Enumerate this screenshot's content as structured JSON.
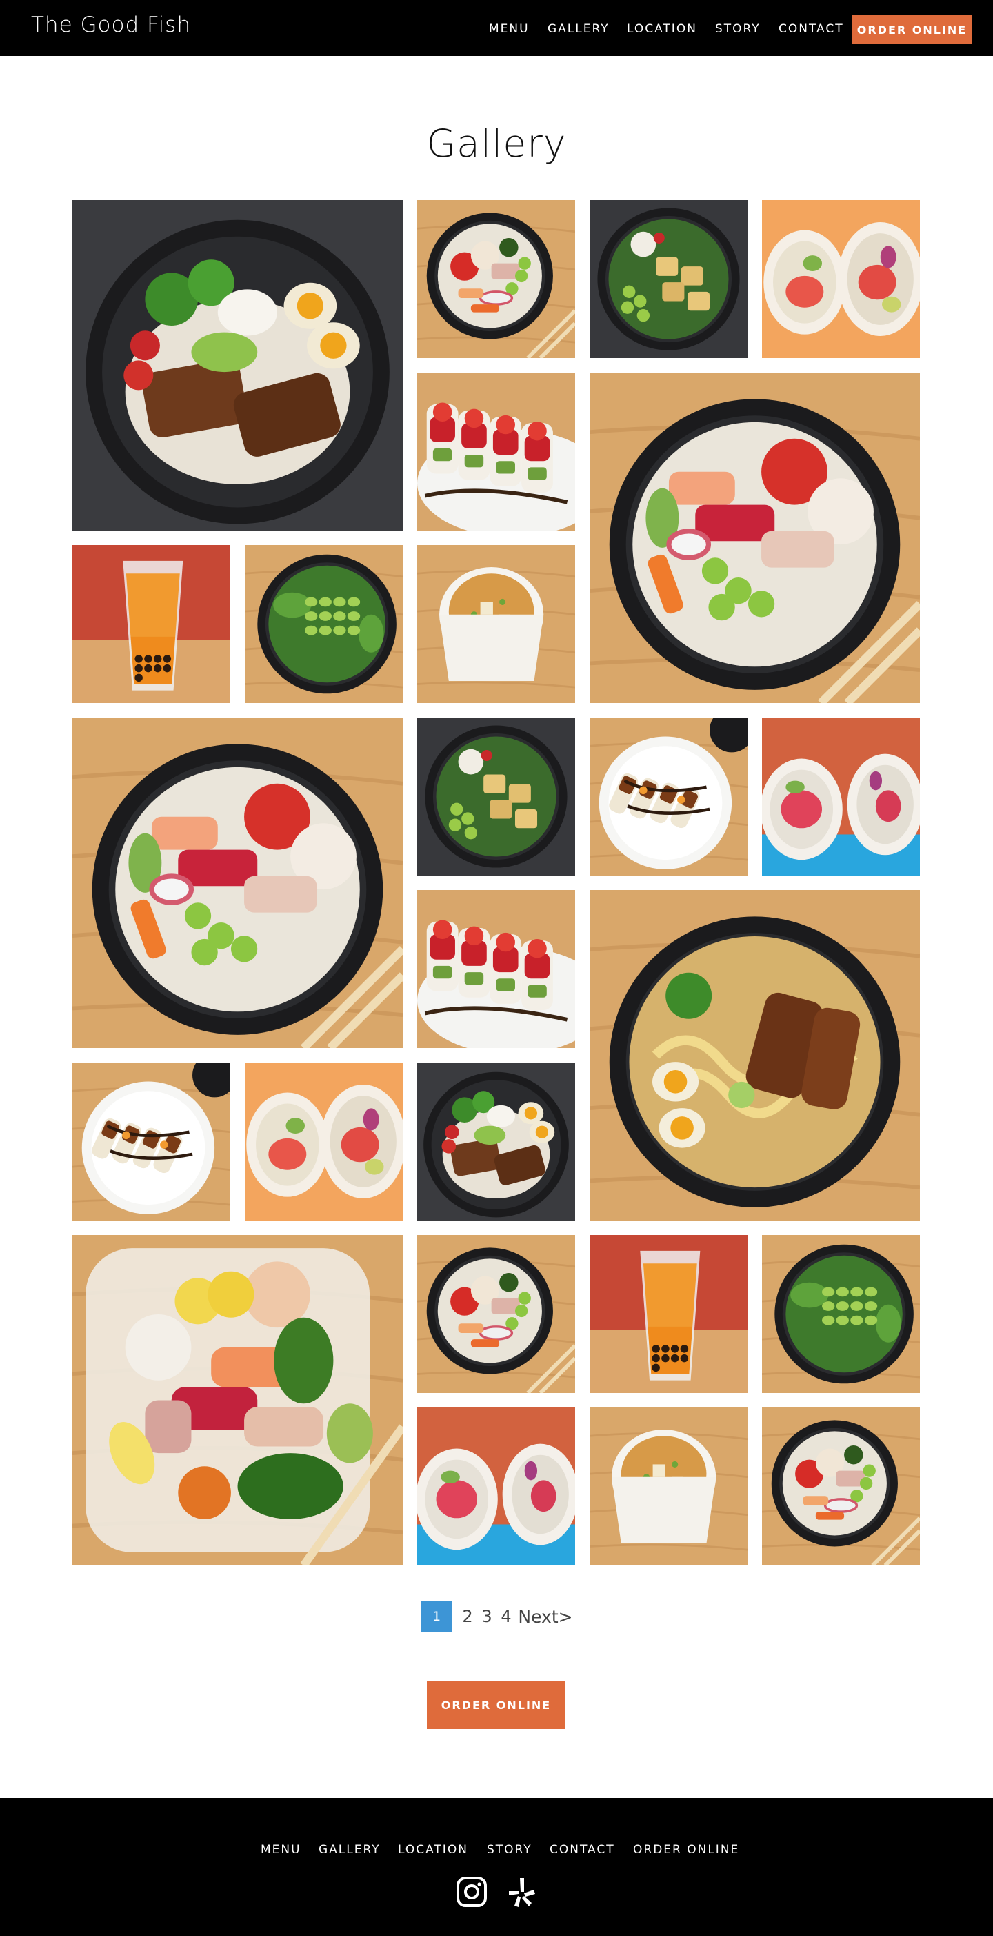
{
  "header": {
    "brand": "The Good Fish",
    "nav": [
      "MENU",
      "GALLERY",
      "LOCATION",
      "STORY",
      "CONTACT"
    ],
    "order_button": "ORDER ONLINE"
  },
  "page_title": "Gallery",
  "pagination": {
    "pages": [
      "1",
      "2",
      "3",
      "4"
    ],
    "current": "1",
    "next_label": "Next>"
  },
  "order_button_main": "ORDER ONLINE",
  "footer": {
    "links": [
      "MENU",
      "GALLERY",
      "LOCATION",
      "STORY",
      "CONTACT",
      "ORDER ONLINE"
    ],
    "social_icons": [
      "instagram-icon",
      "yelp-icon"
    ]
  },
  "gallery": {
    "photos": [
      {
        "subject": "pork-rice-bowl"
      },
      {
        "subject": "poke-bowl"
      },
      {
        "subject": "tofu-bowl"
      },
      {
        "subject": "sushi-burrito"
      },
      {
        "subject": "sushi-roll"
      },
      {
        "subject": "poke-bowl-large"
      },
      {
        "subject": "thai-tea"
      },
      {
        "subject": "edamame-salad"
      },
      {
        "subject": "miso-soup"
      },
      {
        "subject": "poke-bowl-large"
      },
      {
        "subject": "tofu-bowl"
      },
      {
        "subject": "eel-roll-plate"
      },
      {
        "subject": "sushi-burrito-blue"
      },
      {
        "subject": "sushi-roll"
      },
      {
        "subject": "ramen-bowl"
      },
      {
        "subject": "eel-roll-plate"
      },
      {
        "subject": "sushi-burrito"
      },
      {
        "subject": "pork-rice-bowl"
      },
      {
        "subject": "sashimi-platter"
      },
      {
        "subject": "poke-bowl"
      },
      {
        "subject": "thai-tea"
      },
      {
        "subject": "edamame-salad"
      },
      {
        "subject": "sushi-burrito-blue"
      },
      {
        "subject": "miso-soup"
      },
      {
        "subject": "poke-bowl"
      }
    ]
  }
}
